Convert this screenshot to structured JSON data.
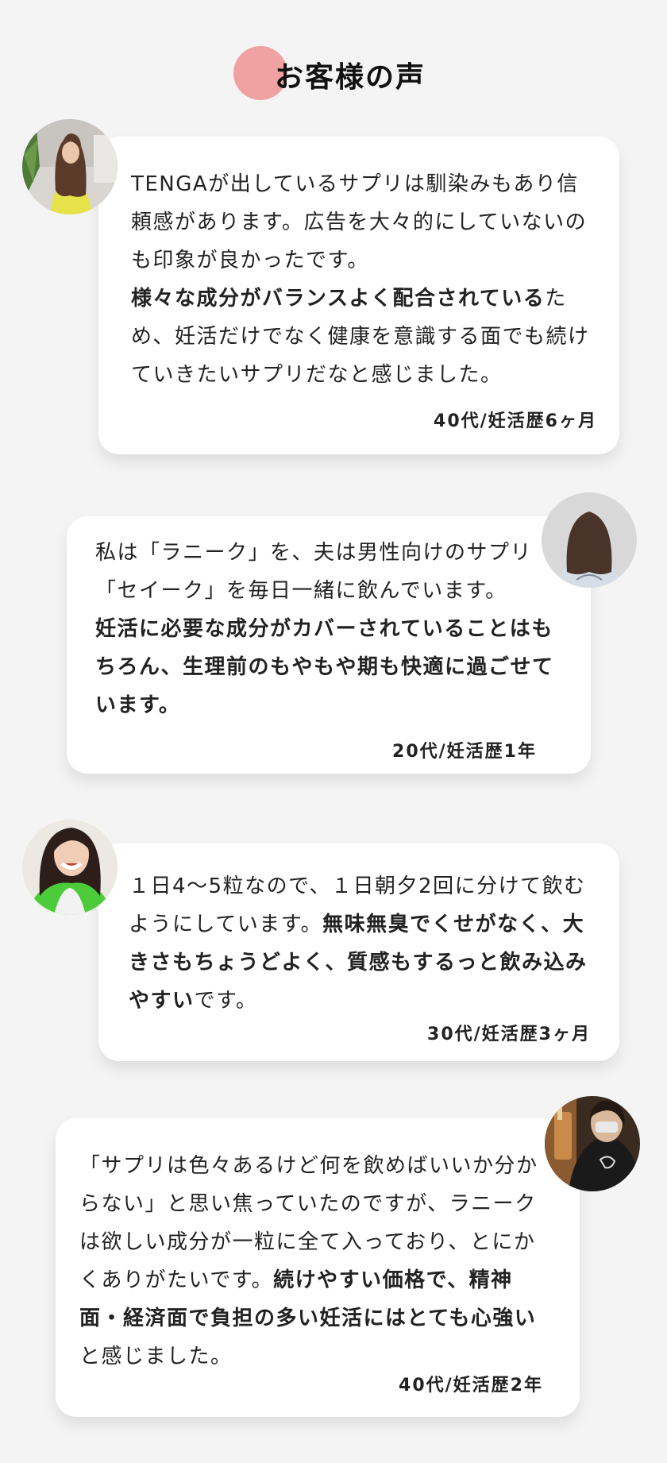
{
  "heading": {
    "title": "お客様の声",
    "accent_color": "#f0a1a1"
  },
  "reviews": [
    {
      "parts": [
        {
          "text": "TENGAが出しているサプリは馴染みもあり信頼感があります。広告を大々的にしていないのも印象が良かったです。",
          "bold": false
        },
        {
          "text": "様々な成分がバランスよく配合されている",
          "bold": true
        },
        {
          "text": "ため、妊活だけでなく健康を意識する面でも続けていきたいサプリだなと感じました。",
          "bold": false
        }
      ],
      "meta": "40代/妊活歴6ヶ月",
      "avatar_icon": "woman-long-hair-yellow-top-photo"
    },
    {
      "parts": [
        {
          "text": "私は「ラニーク」を、夫は男性向けのサプリ「セイーク」を毎日一緒に飲んでいます。",
          "bold": false
        },
        {
          "text": "妊活に必要な成分がカバーされていることはもちろん、生理前のもやもや期も快適に過ごせています。",
          "bold": true
        }
      ],
      "meta": "20代/妊活歴1年",
      "avatar_icon": "woman-back-view-photo"
    },
    {
      "parts": [
        {
          "text": "１日4〜5粒なので、１日朝夕2回に分けて飲むようにしています。",
          "bold": false
        },
        {
          "text": "無味無臭でくせがなく、大きさもちょうどよく、質感もするっと飲み込みやすい",
          "bold": true
        },
        {
          "text": "です。",
          "bold": false
        }
      ],
      "meta": "30代/妊活歴3ヶ月",
      "avatar_icon": "smiling-woman-green-vest-photo"
    },
    {
      "parts": [
        {
          "text": "「サプリは色々あるけど何を飲めばいいか分からない」と思い焦っていたのですが、ラニークは欲しい成分が一粒に全て入っており、とにかくありがたいです。",
          "bold": false
        },
        {
          "text": "続けやすい価格で、精神面・経済面で負担の多い妊活にはとても心強い",
          "bold": true
        },
        {
          "text": "と感じました。",
          "bold": false
        }
      ],
      "meta": "40代/妊活歴2年",
      "avatar_icon": "woman-with-drink-photo"
    }
  ]
}
